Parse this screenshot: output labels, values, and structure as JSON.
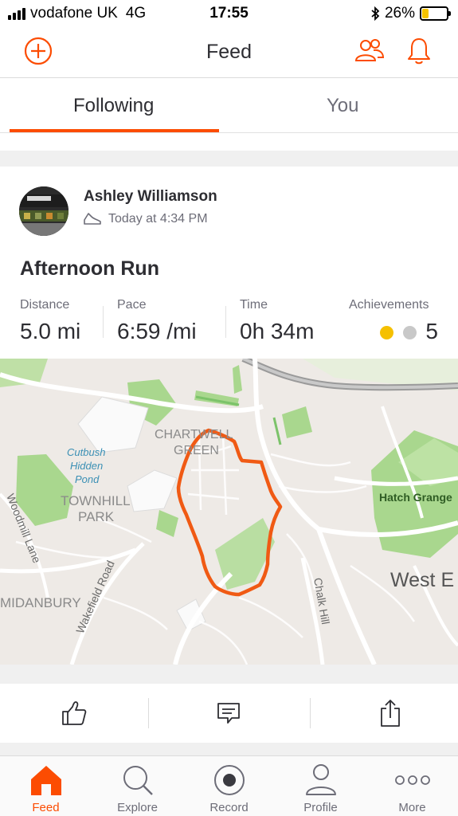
{
  "status_bar": {
    "carrier": "vodafone UK",
    "network": "4G",
    "time": "17:55",
    "battery_percent": "26%",
    "battery_level": 0.26,
    "battery_color": "#f5c400"
  },
  "header": {
    "title": "Feed",
    "left_icon": "add-circle-icon",
    "right_icons": [
      "people-icon",
      "bell-icon"
    ]
  },
  "tabs": [
    {
      "label": "Following",
      "active": true
    },
    {
      "label": "You",
      "active": false
    }
  ],
  "activity": {
    "athlete_name": "Ashley Williamson",
    "timestamp": "Today at 4:34 PM",
    "sport_icon": "shoe-icon",
    "title": "Afternoon Run",
    "stats": {
      "distance": {
        "label": "Distance",
        "value": "5.0 mi"
      },
      "pace": {
        "label": "Pace",
        "value": "6:59 /mi"
      },
      "time": {
        "label": "Time",
        "value": "0h 34m"
      },
      "achievements": {
        "label": "Achievements",
        "value": "5",
        "medals": [
          "gold",
          "silver"
        ]
      }
    },
    "map_labels": {
      "chartwell": "CHARTWELL",
      "green": "GREEN",
      "cutbush": "Cutbush",
      "hidden": "Hidden",
      "pond": "Pond",
      "townhill": "TOWNHILL",
      "park": "PARK",
      "woodmill": "Woodmill Lane",
      "wakefield": "Wakefield Road",
      "midanbury": "MIDANBURY",
      "chalk_hill": "Chalk Hill",
      "hatch_grange": "Hatch Grange",
      "west_end": "West E"
    },
    "actions": [
      "kudos-thumb-icon",
      "comment-icon",
      "share-icon"
    ]
  },
  "bottom_nav": [
    {
      "label": "Feed",
      "icon": "home-icon",
      "active": true
    },
    {
      "label": "Explore",
      "icon": "search-icon",
      "active": false
    },
    {
      "label": "Record",
      "icon": "record-icon",
      "active": false
    },
    {
      "label": "Profile",
      "icon": "profile-icon",
      "active": false
    },
    {
      "label": "More",
      "icon": "more-dots-icon",
      "active": false
    }
  ],
  "colors": {
    "accent": "#fc4c02",
    "route": "#f05a14",
    "text": "#2d2d32",
    "muted": "#6d6d78",
    "map_background": "#eeeae6",
    "map_park": "#a8d68c",
    "medal_gold": "#f5c000",
    "medal_silver": "#c8c8c8"
  }
}
